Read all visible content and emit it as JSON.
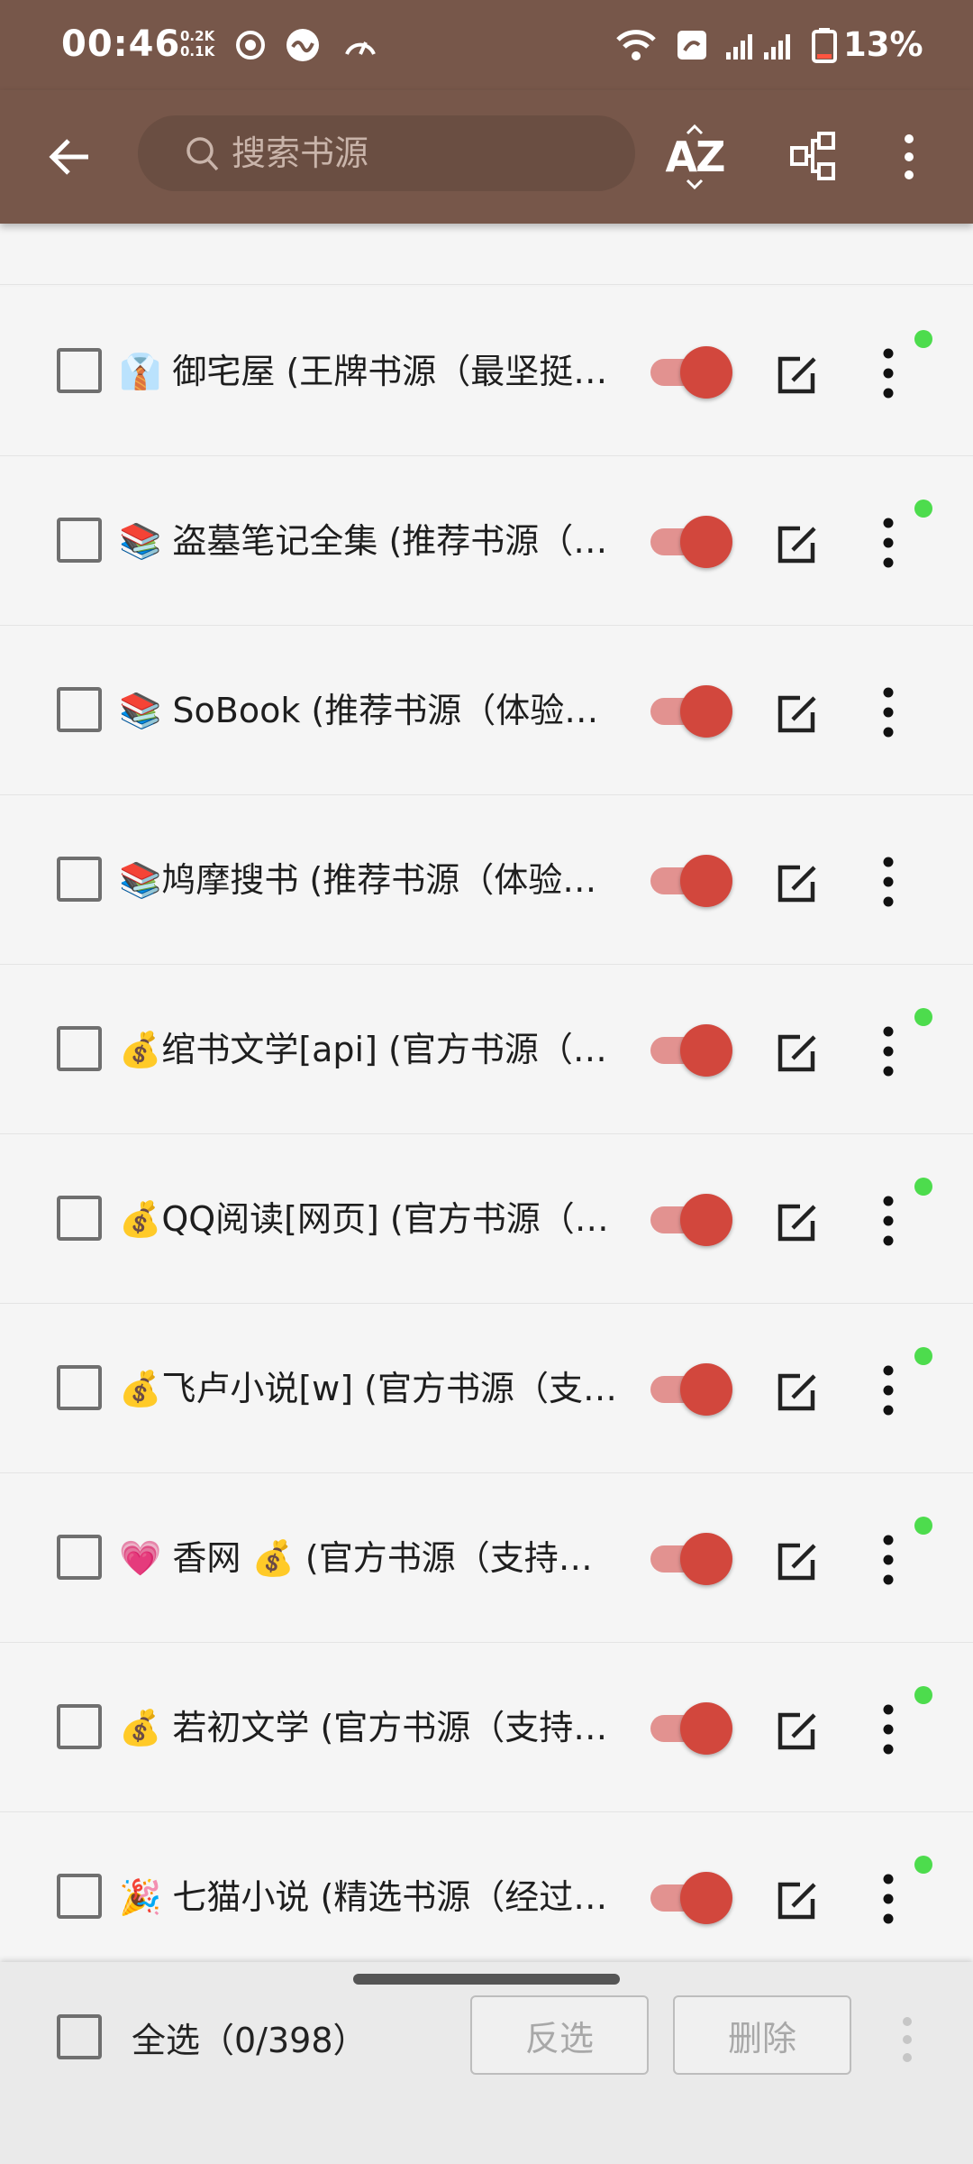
{
  "status_bar": {
    "time": "00:46",
    "net_up": "0.2K",
    "net_down": "0.1K",
    "battery": "13%"
  },
  "toolbar": {
    "search_placeholder": "搜索书源",
    "sort_label": "AZ"
  },
  "sources": [
    {
      "name": "👔 御宅屋 (王牌书源（最坚挺…",
      "enabled": true,
      "status_dot": true
    },
    {
      "name": "📚 盗墓笔记全集 (推荐书源（…",
      "enabled": true,
      "status_dot": true
    },
    {
      "name": "📚 SoBook (推荐书源（体验不…",
      "enabled": true,
      "status_dot": false
    },
    {
      "name": "📚鸠摩搜书 (推荐书源（体验…",
      "enabled": true,
      "status_dot": false
    },
    {
      "name": "💰绾书文学[api] (官方书源（…",
      "enabled": true,
      "status_dot": true
    },
    {
      "name": "💰QQ阅读[网页] (官方书源（…",
      "enabled": true,
      "status_dot": true
    },
    {
      "name": "💰飞卢小说[w] (官方书源（支…",
      "enabled": true,
      "status_dot": true
    },
    {
      "name": "💗 香网 💰 (官方书源（支持作…",
      "enabled": true,
      "status_dot": true
    },
    {
      "name": "💰 若初文学 (官方书源（支持…",
      "enabled": true,
      "status_dot": true
    },
    {
      "name": "🎉 七猫小说 (精选书源（经过…",
      "enabled": true,
      "status_dot": true
    }
  ],
  "bottom_bar": {
    "select_all_label": "全选（0/398）",
    "invert_label": "反选",
    "delete_label": "删除"
  },
  "colors": {
    "app_bar": "#77574a",
    "switch_thumb": "#d2473d",
    "switch_track": "#e29290",
    "status_dot": "#4ddc4d"
  },
  "icons": {
    "back": "arrow-left",
    "search": "magnifier",
    "sort": "az-sort",
    "group": "group-tree",
    "more": "more-vertical",
    "edit": "edit-square"
  }
}
